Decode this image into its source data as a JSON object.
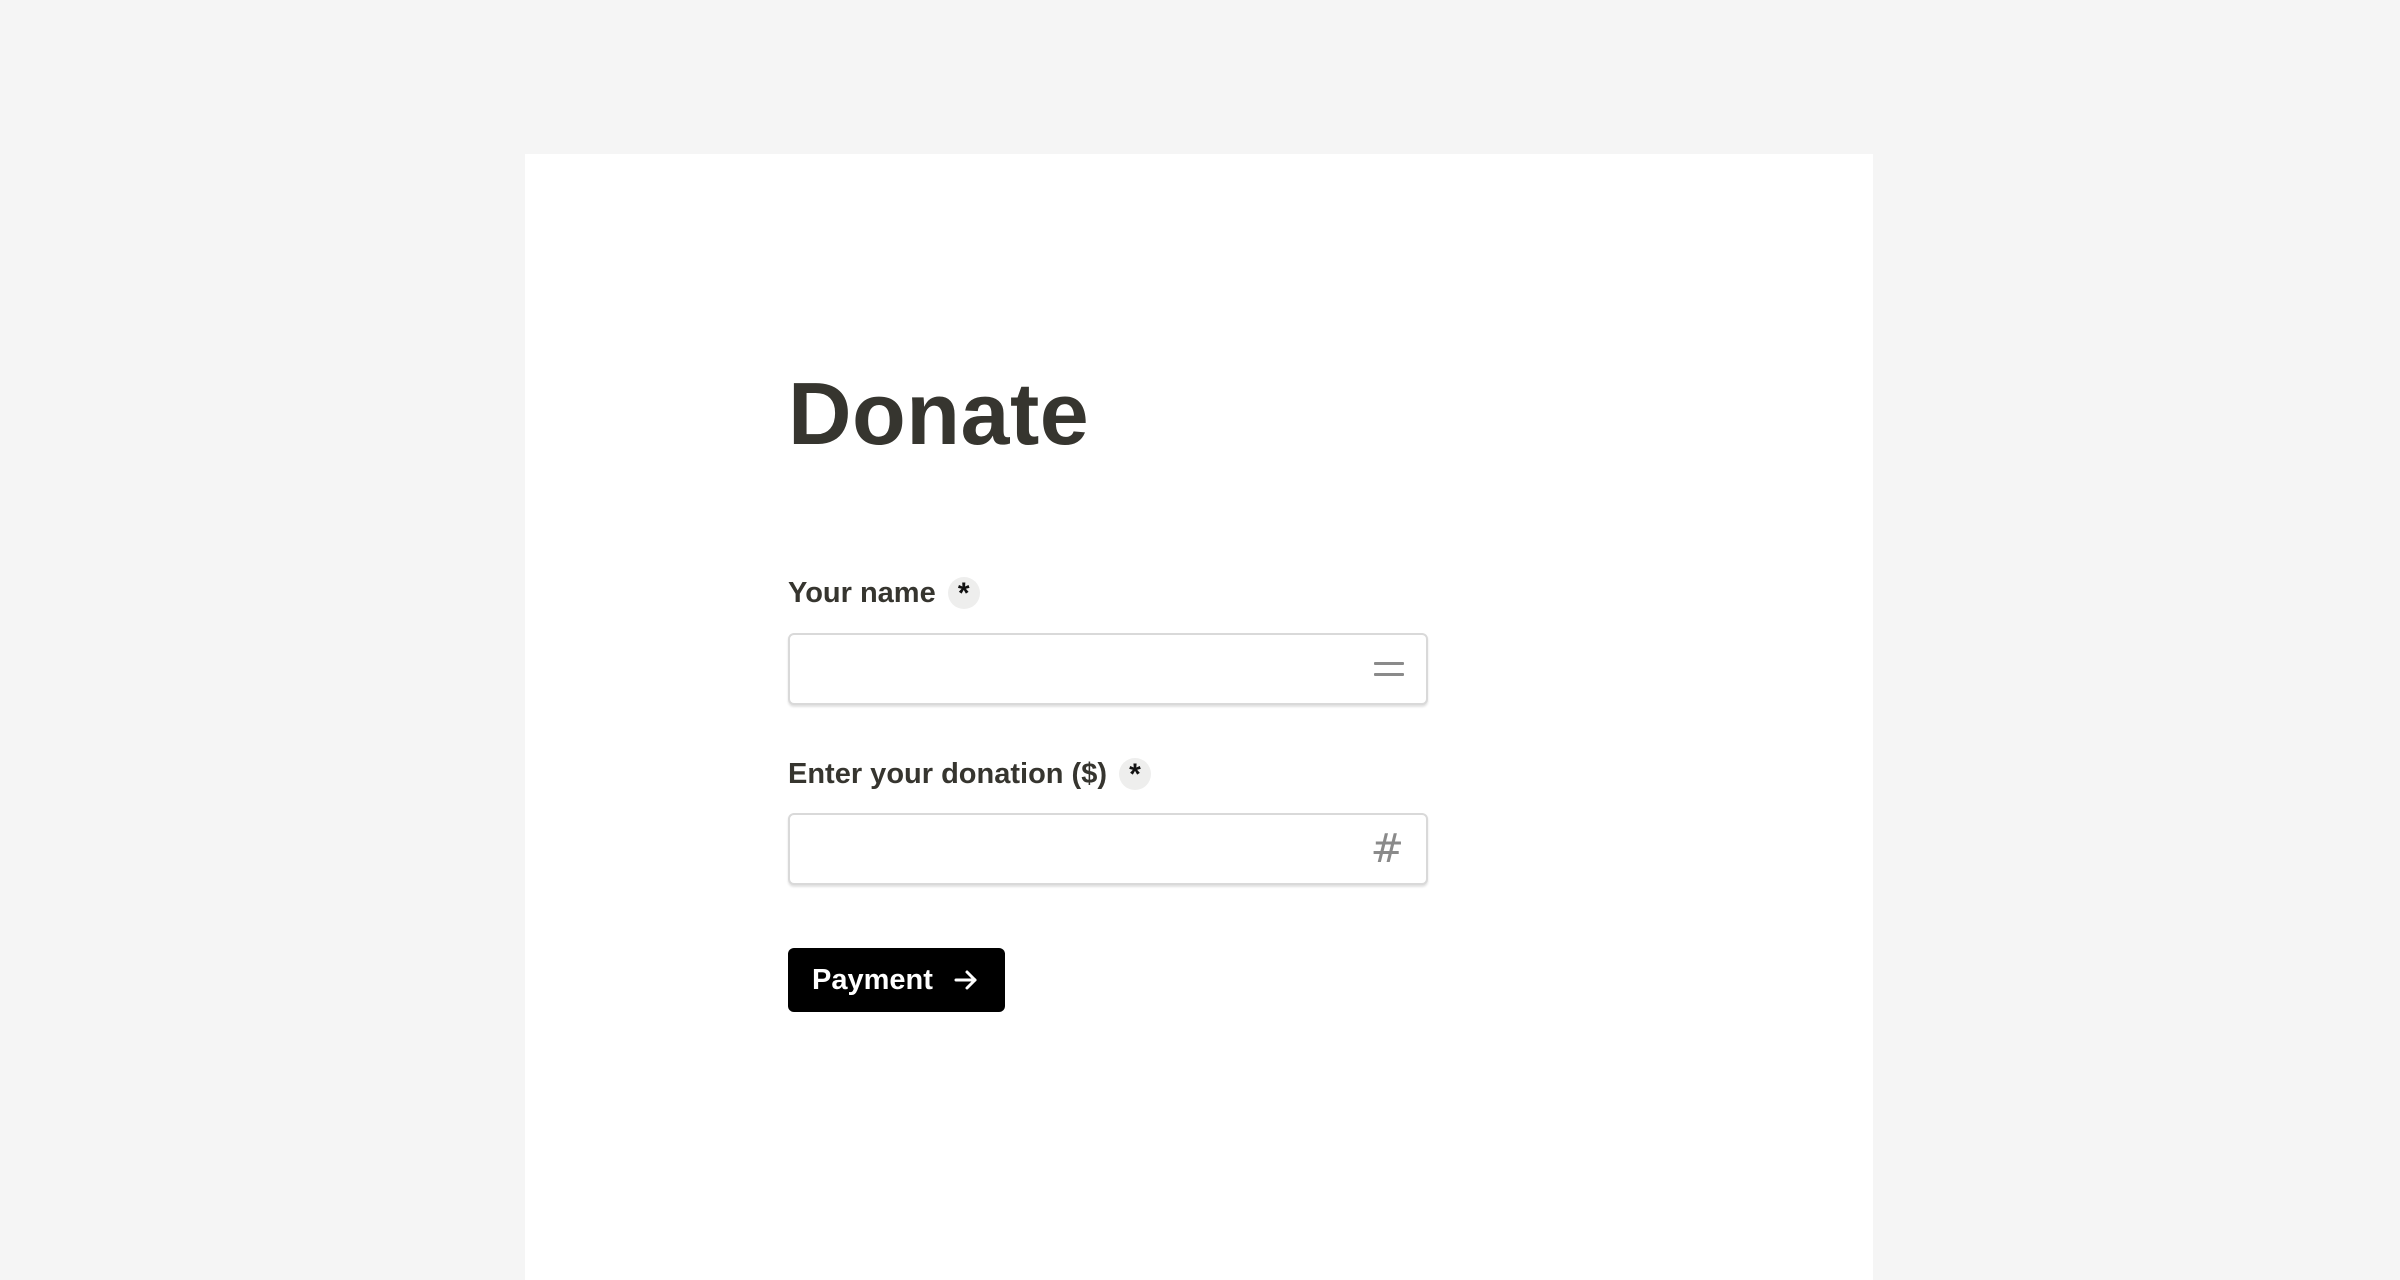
{
  "page": {
    "title": "Donate"
  },
  "fields": {
    "name": {
      "label": "Your name",
      "required_mark": "*",
      "value": "",
      "placeholder": "",
      "icon": "equals-icon"
    },
    "donation": {
      "label": "Enter your donation ($)",
      "required_mark": "*",
      "value": "",
      "placeholder": "",
      "icon": "hash-icon"
    }
  },
  "actions": {
    "payment_label": "Payment",
    "payment_icon": "arrow-right-icon"
  },
  "colors": {
    "page_background": "#f5f5f5",
    "card_background": "#ffffff",
    "text": "#36352f",
    "button_background": "#000000",
    "button_text": "#ffffff",
    "icon": "#8a8a8a"
  }
}
